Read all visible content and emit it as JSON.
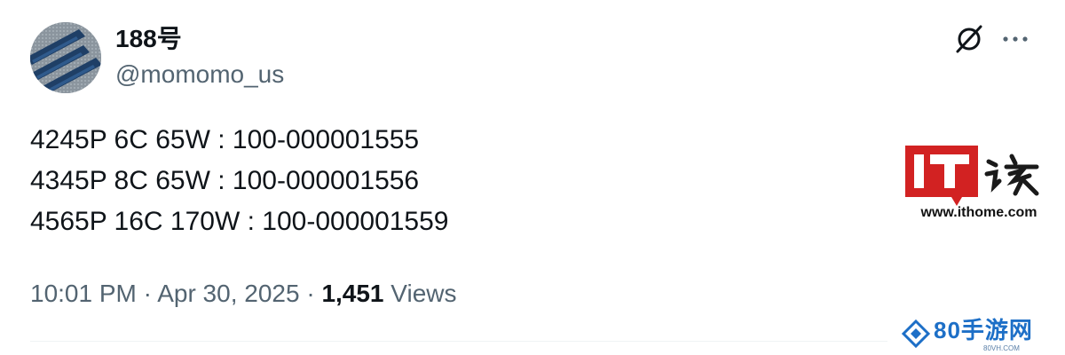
{
  "author": {
    "display_name": "188号",
    "handle": "@momomo_us",
    "avatar_icon": "avatar-image"
  },
  "actions": {
    "grok_icon": "grok-icon",
    "more_icon": "more-icon"
  },
  "tweet": {
    "lines": [
      "4245P 6C 65W : 100-000001555",
      "4345P 8C 65W : 100-000001556",
      "4565P 16C 170W : 100-000001559"
    ],
    "time": "10:01 PM",
    "separator": "·",
    "date": "Apr 30, 2025",
    "views_count": "1,451",
    "views_label": "Views"
  },
  "watermarks": {
    "ithome_url": "www.ithome.com",
    "game_site_name": "80手游网",
    "game_site_url": "80VH.COM"
  },
  "colors": {
    "primary_text": "#0f1419",
    "secondary_text": "#536471",
    "ithome_red": "#d22222"
  }
}
